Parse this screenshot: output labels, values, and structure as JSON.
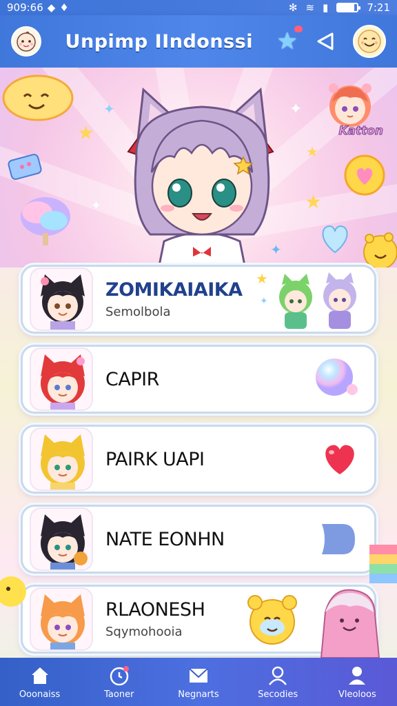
{
  "status_bar": {
    "time_left": "909:66",
    "time_right": "7:21",
    "battery_level": 0.85
  },
  "header": {
    "title": "Unpimp IIndonssi",
    "avatar_icon": "baby-face-icon",
    "actions": [
      "star-icon",
      "share-icon",
      "smiley-profile-icon"
    ]
  },
  "hero": {
    "sticker_label": "Katton",
    "icons": [
      "cat-ear-girl-illustration",
      "heart-balloon-icon",
      "cloud-icon",
      "star-icon",
      "cotton-candy-icon"
    ]
  },
  "contacts": [
    {
      "name": "ZOMIKAIAIKA",
      "subtitle": "Semolbola",
      "highlight": true,
      "extra": "green-and-purple-chibi-friends"
    },
    {
      "name": "CAPIR",
      "subtitle": "",
      "highlight": false,
      "extra": "bubble-icon"
    },
    {
      "name": "PAIRK UAPI",
      "subtitle": "",
      "highlight": false,
      "extra": "heart-icon"
    },
    {
      "name": "NATE EONHN",
      "subtitle": "",
      "highlight": false,
      "extra": "speech-bubble-icon"
    },
    {
      "name": "RLAONESH",
      "subtitle": "Sqymohooia",
      "highlight": false,
      "extra": "bear-and-pink-creature"
    }
  ],
  "bottom_nav": [
    {
      "label": "Ooonaiss",
      "icon": "home-icon"
    },
    {
      "label": "Taoner",
      "icon": "clock-icon"
    },
    {
      "label": "Negnarts",
      "icon": "envelope-icon"
    },
    {
      "label": "Secodies",
      "icon": "user-outline-icon"
    },
    {
      "label": "Vleoloos",
      "icon": "user-filled-icon"
    }
  ],
  "colors": {
    "header_blue": "#3f77db",
    "accent_name": "#21418d",
    "heart_red": "#ee3350"
  }
}
